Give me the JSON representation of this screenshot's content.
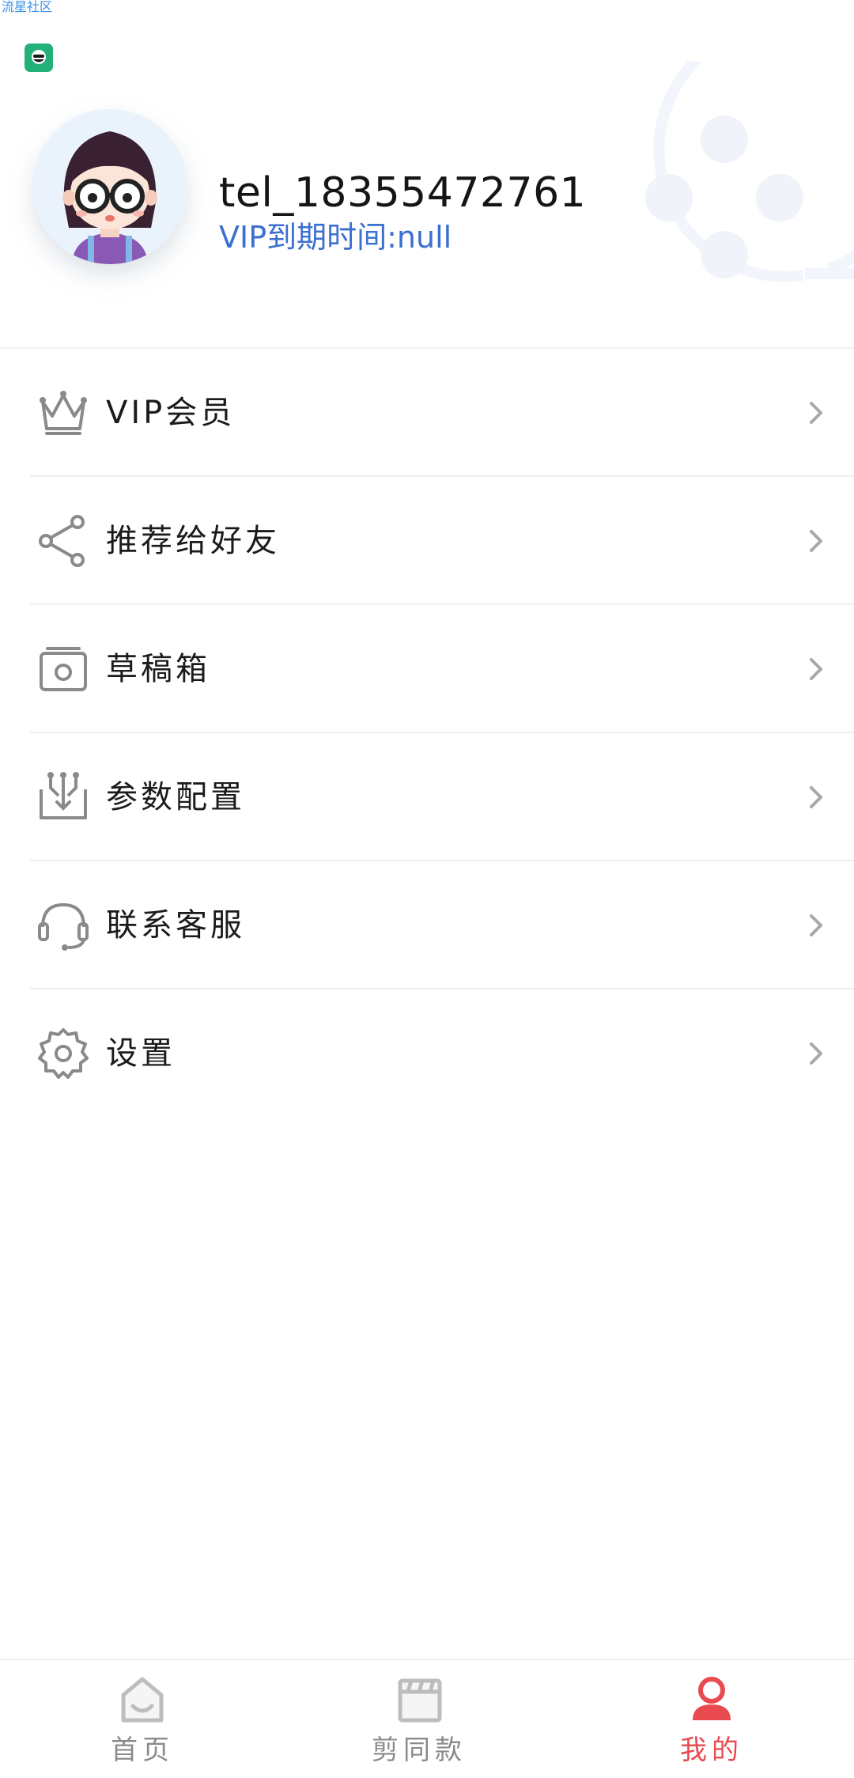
{
  "watermark": {
    "text": "流星社区"
  },
  "colors": {
    "accent_red": "#e84a4f",
    "vip_blue": "#3b6fd0",
    "icon_gray": "#8a8a8a",
    "app_badge_green": "#23b07a"
  },
  "profile": {
    "username": "tel_18355472761",
    "vip_expire": "VIP到期时间:null"
  },
  "menu": {
    "items": [
      {
        "label": "VIP会员",
        "icon": "crown-icon"
      },
      {
        "label": "推荐给好友",
        "icon": "share-icon"
      },
      {
        "label": "草稿箱",
        "icon": "drafts-box-icon"
      },
      {
        "label": "参数配置",
        "icon": "config-icon"
      },
      {
        "label": "联系客服",
        "icon": "headset-icon"
      },
      {
        "label": "设置",
        "icon": "gear-icon"
      }
    ]
  },
  "tabbar": {
    "tabs": [
      {
        "label": "首页",
        "icon": "home-icon",
        "active": false
      },
      {
        "label": "剪同款",
        "icon": "clapperboard-icon",
        "active": false
      },
      {
        "label": "我的",
        "icon": "user-icon",
        "active": true
      }
    ]
  }
}
